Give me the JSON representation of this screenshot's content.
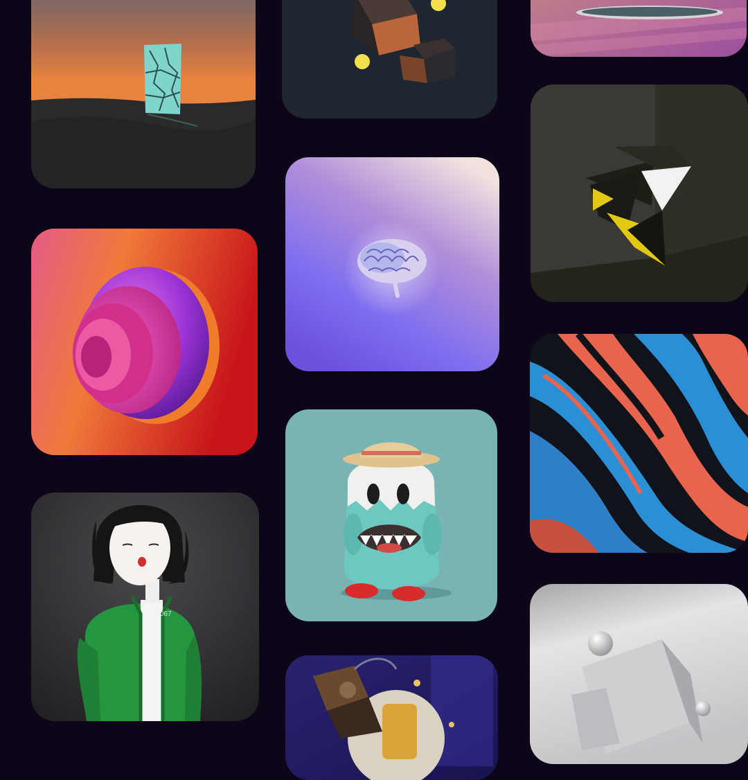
{
  "gallery": {
    "cards": [
      {
        "id": "desert",
        "icon": "mirror-monolith-desert-artwork",
        "colors": {
          "sky_top": "#5d6470",
          "sky_bottom": "#e7833f",
          "ground": "#2a2a2c"
        }
      },
      {
        "id": "cubes",
        "icon": "floating-cubes-artwork",
        "colors": {
          "bg": "#1e2631",
          "glow": "#f4e04d"
        }
      },
      {
        "id": "pool",
        "icon": "pool-scene-artwork",
        "colors": {
          "bg": "#b5639e"
        }
      },
      {
        "id": "swirl",
        "icon": "purple-swirl-artwork",
        "colors": {
          "bg_left": "#e2537d",
          "bg_right": "#d8231b",
          "swirl": "#9b33d6"
        }
      },
      {
        "id": "brain",
        "icon": "glowing-brain-artwork",
        "colors": {
          "top": "#eadfe6",
          "bottom": "#6f57e3"
        }
      },
      {
        "id": "origami",
        "icon": "yellow-origami-artwork",
        "colors": {
          "bg": "#2c2c26",
          "accent": "#e1c913"
        }
      },
      {
        "id": "paint",
        "icon": "fluid-paint-artwork",
        "colors": {
          "blue": "#2b8fd6",
          "orange": "#e8644e",
          "dark": "#101319"
        }
      },
      {
        "id": "monster",
        "icon": "hat-monster-artwork",
        "colors": {
          "bg": "#79b4b4",
          "body": "#6fc8c0",
          "hat": "#e0c28c"
        }
      },
      {
        "id": "girl",
        "icon": "girl-green-jacket-artwork",
        "colors": {
          "bg": "#343336",
          "jacket": "#24963f"
        }
      },
      {
        "id": "robot",
        "icon": "mechanical-robot-artwork",
        "colors": {
          "bg": "#2a2270"
        }
      },
      {
        "id": "marble",
        "icon": "white-shapes-artwork",
        "colors": {
          "bg": "#d5d5d7"
        }
      }
    ],
    "labels": {
      "girl_jacket_text": "067"
    }
  }
}
